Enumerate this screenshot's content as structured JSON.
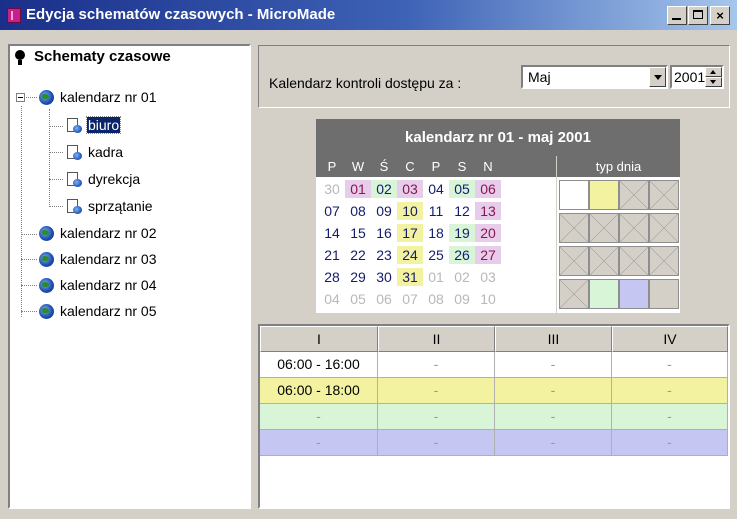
{
  "window": {
    "title": "Edycja schematów czasowych - MicroMade",
    "minimize_label": "",
    "maximize_label": "",
    "close_label": "×"
  },
  "tree": {
    "root_label": "Schematy czasowe",
    "calendars": [
      {
        "label": "kalendarz nr 01",
        "expanded": true,
        "children": [
          "biuro",
          "kadra",
          "dyrekcja",
          "sprzątanie"
        ]
      },
      {
        "label": "kalendarz nr 02"
      },
      {
        "label": "kalendarz nr 03"
      },
      {
        "label": "kalendarz nr 04"
      },
      {
        "label": "kalendarz nr 05"
      }
    ],
    "selected": "biuro"
  },
  "controls": {
    "label": "Kalendarz kontroli dostępu za :",
    "month": "Maj",
    "year": "2001"
  },
  "calendar": {
    "title": "kalendarz nr 01 - maj 2001",
    "weekdays": [
      "P",
      "W",
      "Ś",
      "C",
      "P",
      "S",
      "N"
    ],
    "typ_label": "typ dnia",
    "weeks": [
      [
        "30",
        "01",
        "02",
        "03",
        "04",
        "05",
        "06"
      ],
      [
        "07",
        "08",
        "09",
        "10",
        "11",
        "12",
        "13"
      ],
      [
        "14",
        "15",
        "16",
        "17",
        "18",
        "19",
        "20"
      ],
      [
        "21",
        "22",
        "23",
        "24",
        "25",
        "26",
        "27"
      ],
      [
        "28",
        "29",
        "30",
        "31",
        "01",
        "02",
        "03"
      ],
      [
        "04",
        "05",
        "06",
        "07",
        "08",
        "09",
        "10"
      ]
    ],
    "day_colors": {
      "pink": "#e7cdea",
      "green": "#d8f5d8",
      "yellow": "#f2f2a0"
    },
    "typ_colors": {
      "white": "#ffffff",
      "yellow": "#f2f2a0",
      "green": "#d8f5d8",
      "blue": "#c6c6f2",
      "grey": "#d4d0c8"
    }
  },
  "schedule": {
    "columns": [
      "I",
      "II",
      "III",
      "IV"
    ],
    "rows": [
      {
        "color": "white",
        "cells": [
          "06:00 - 16:00",
          "-",
          "-",
          "-"
        ]
      },
      {
        "color": "yellow",
        "cells": [
          "06:00 - 18:00",
          "-",
          "-",
          "-"
        ]
      },
      {
        "color": "green",
        "cells": [
          "-",
          "-",
          "-",
          "-"
        ]
      },
      {
        "color": "blue",
        "cells": [
          "-",
          "-",
          "-",
          "-"
        ]
      }
    ]
  }
}
